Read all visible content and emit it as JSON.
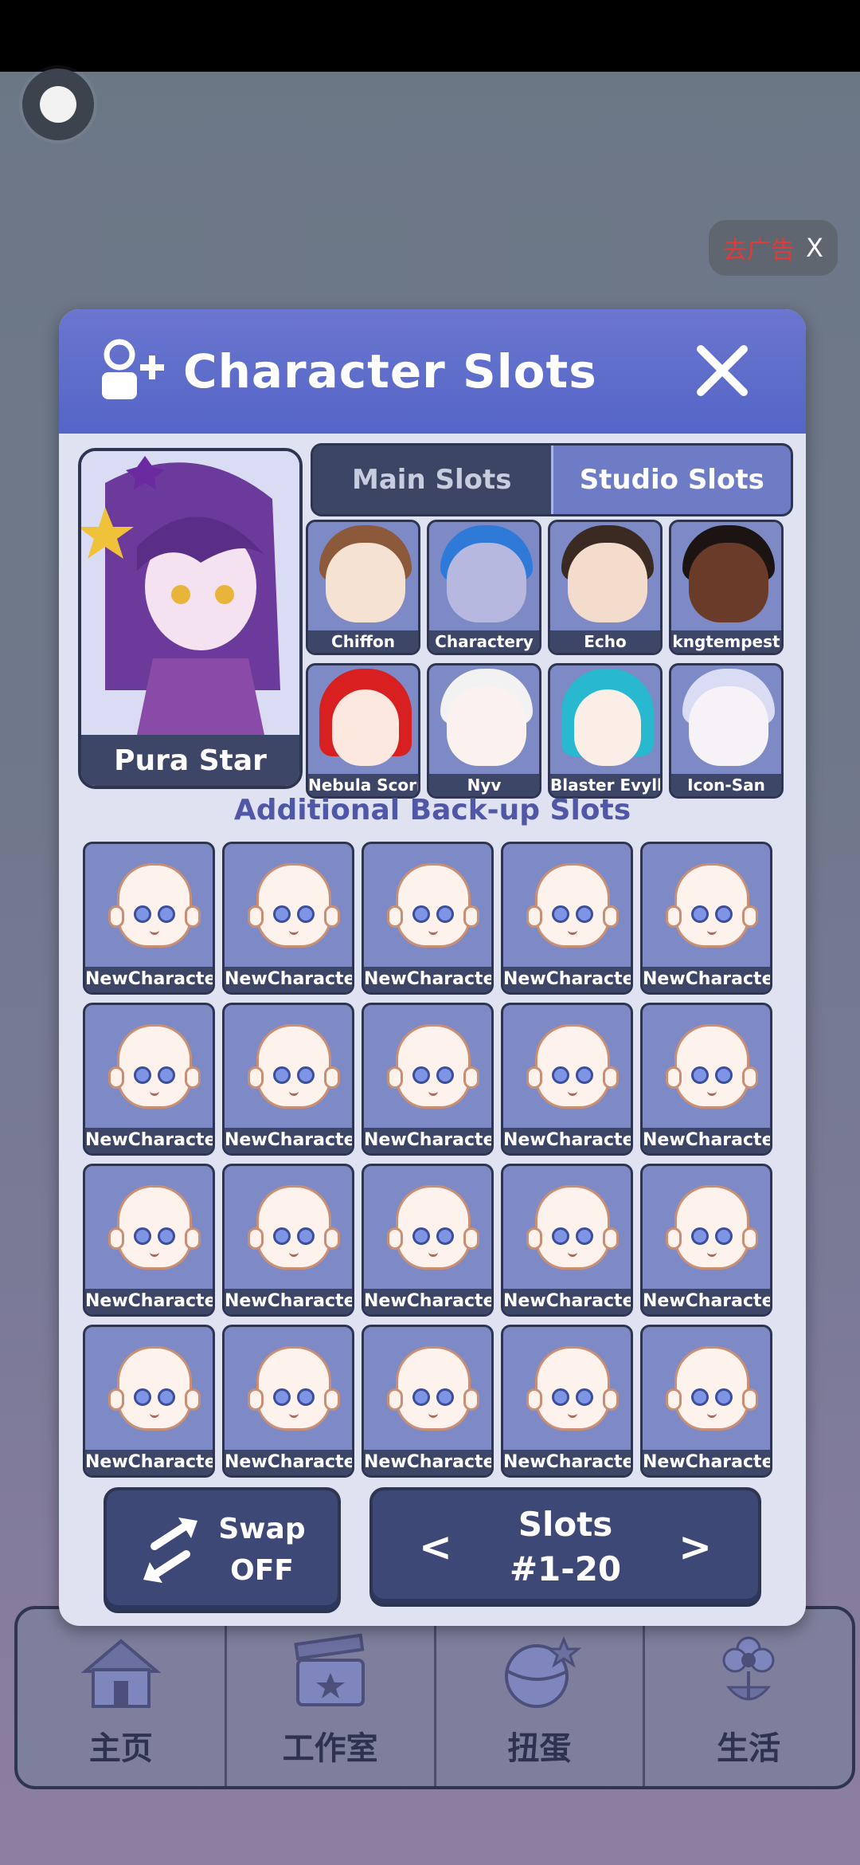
{
  "ad": {
    "text": "去广告",
    "close": "X"
  },
  "modal": {
    "title": "Character Slots"
  },
  "featured": {
    "name": "Pura Star"
  },
  "tabs": {
    "main": "Main Slots",
    "studio": "Studio Slots"
  },
  "studio_slots": [
    {
      "name": "Chiffon",
      "hair": "#8c5a3a",
      "skin": "#f6e2d2"
    },
    {
      "name": "Charactery",
      "hair": "#2f7ad8",
      "skin": "#b7b8e0"
    },
    {
      "name": "Echo",
      "hair": "#3a2a22",
      "skin": "#f4dccc"
    },
    {
      "name": "kngtempest",
      "hair": "#1c1412",
      "skin": "#6b3b2a"
    },
    {
      "name": "Nebula Scorpi",
      "hair": "#d82020",
      "skin": "#fde8e0"
    },
    {
      "name": "Nyv",
      "hair": "#f2f2f2",
      "skin": "#fbf1ee"
    },
    {
      "name": "Blaster Evylln",
      "hair": "#28b8d0",
      "skin": "#fbeee6"
    },
    {
      "name": "Icon-San",
      "hair": "#d9dcf2",
      "skin": "#f6f2f8"
    }
  ],
  "backup": {
    "title": "Additional Back-up Slots",
    "slots": [
      "NewCharacter",
      "NewCharacter",
      "NewCharacter",
      "NewCharacter",
      "NewCharacter",
      "NewCharacter",
      "NewCharacter",
      "NewCharacter",
      "NewCharacter",
      "NewCharacter",
      "NewCharacter",
      "NewCharacter",
      "NewCharacter",
      "NewCharacter",
      "NewCharacter",
      "NewCharacter",
      "NewCharacter",
      "NewCharacter",
      "NewCharacter",
      "NewCharacter"
    ]
  },
  "swap": {
    "line1": "Swap",
    "line2": "OFF"
  },
  "slots_nav": {
    "line1": "Slots",
    "line2": "#1-20",
    "prev": "<",
    "next": ">"
  },
  "bottom_nav": [
    {
      "label": "主页",
      "icon": "house-icon"
    },
    {
      "label": "工作室",
      "icon": "clapperboard-icon"
    },
    {
      "label": "扭蛋",
      "icon": "gacha-ball-icon"
    },
    {
      "label": "生活",
      "icon": "flower-icon"
    }
  ]
}
